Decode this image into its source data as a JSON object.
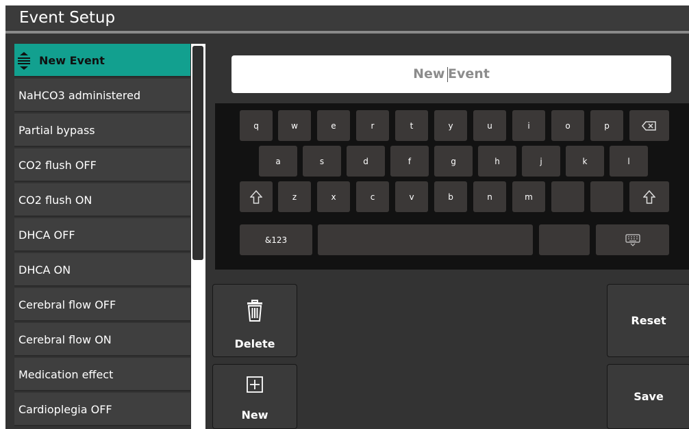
{
  "header": {
    "title": "Event Setup"
  },
  "event_list": {
    "items": [
      "New Event",
      "NaHCO3 administered",
      "Partial bypass",
      "CO2 flush OFF",
      "CO2 flush ON",
      "DHCA OFF",
      "DHCA ON",
      "Cerebral flow OFF",
      "Cerebral flow ON",
      "Medication effect",
      "Cardioplegia OFF"
    ],
    "selected_index": 0
  },
  "event_name_input": {
    "value": "New Event"
  },
  "keyboard": {
    "row1": [
      "q",
      "w",
      "e",
      "r",
      "t",
      "y",
      "u",
      "i",
      "o",
      "p"
    ],
    "row2": [
      "a",
      "s",
      "d",
      "f",
      "g",
      "h",
      "j",
      "k",
      "l"
    ],
    "row3": [
      "z",
      "x",
      "c",
      "v",
      "b",
      "n",
      "m"
    ],
    "mode_key": "&123"
  },
  "buttons": {
    "delete": "Delete",
    "new": "New",
    "reset": "Reset",
    "save": "Save"
  },
  "icons": {
    "backspace": "backspace-icon",
    "shift": "shift-icon",
    "hide_keyboard": "keyboard-hide-icon",
    "delete": "trash-icon",
    "new": "plus-box-icon",
    "list_drag": "drag-handle-icon"
  },
  "colors": {
    "accent": "#12a08f",
    "background": "#333333",
    "keyboard_bg": "#121212",
    "key": "#3b3837"
  }
}
